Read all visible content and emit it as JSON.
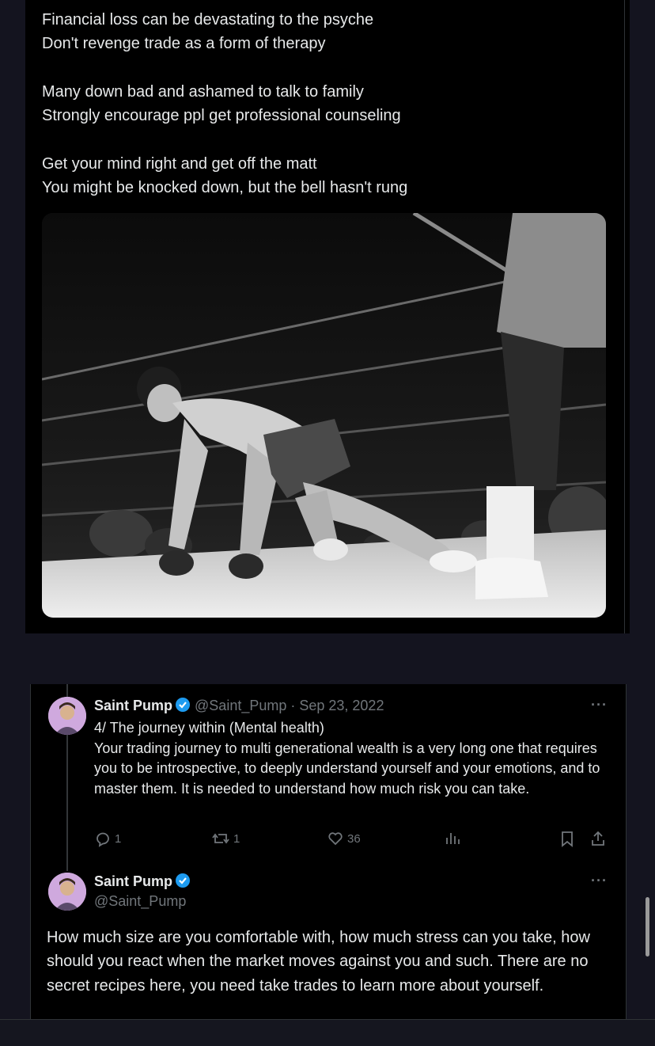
{
  "top_post": {
    "lines_group1": [
      "Financial loss can be devastating to the psyche",
      "Don't revenge trade as a form of therapy"
    ],
    "lines_group2": [
      "Many down bad and ashamed to talk to family",
      "Strongly encourage ppl get professional counseling"
    ],
    "lines_group3": [
      "Get your mind right and get off the matt",
      "You might be knocked down, but the bell hasn't rung"
    ]
  },
  "post1": {
    "name": "Saint Pump",
    "handle_date": "@Saint_Pump · Sep 23, 2022",
    "title": "4/ The journey within (Mental health)",
    "body": "Your trading journey to multi generational wealth is a very long one that requires you to be introspective, to deeply understand yourself and your emotions, and to master them. It is needed to understand how much risk you can take.",
    "more": "···",
    "replies": "1",
    "reposts": "1",
    "likes": "36"
  },
  "post2": {
    "name": "Saint Pump",
    "handle": "@Saint_Pump",
    "more": "···",
    "body": "How much size are you comfortable with, how much stress can you take, how should you react when the market moves against you and such. There are no secret recipes here, you need take trades to learn more about yourself."
  },
  "colors": {
    "background": "#000000",
    "page": "#14141f",
    "muted": "#71767b",
    "verified": "#1d9bf0",
    "text": "#e7e9ea"
  },
  "icons": [
    "verified-icon",
    "reply-icon",
    "repost-icon",
    "like-icon",
    "views-icon",
    "bookmark-icon",
    "share-icon",
    "more-icon"
  ]
}
